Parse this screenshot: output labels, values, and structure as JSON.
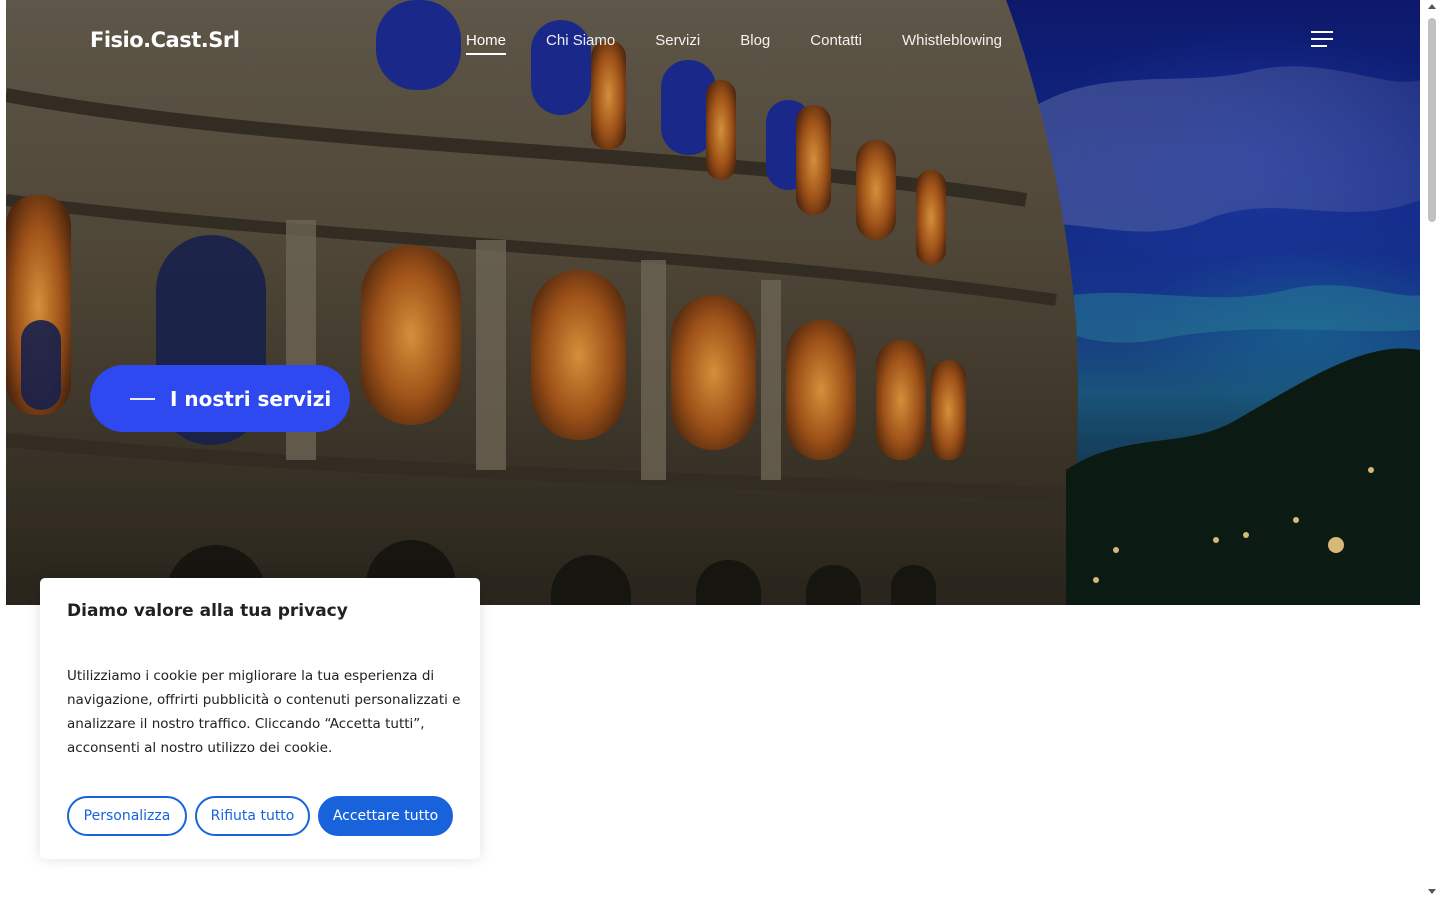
{
  "header": {
    "logo": "Fisio.Cast.Srl",
    "nav": [
      {
        "label": "Home",
        "active": true
      },
      {
        "label": "Chi Siamo",
        "active": false
      },
      {
        "label": "Servizi",
        "active": false
      },
      {
        "label": "Blog",
        "active": false
      },
      {
        "label": "Contatti",
        "active": false
      },
      {
        "label": "Whistleblowing",
        "active": false
      }
    ],
    "menu_icon": "hamburger-menu-icon"
  },
  "hero": {
    "cta_label": "I nostri servizi",
    "background": "colosseum-night-photo"
  },
  "cookie_banner": {
    "title": "Diamo valore alla tua privacy",
    "text": "Utilizziamo i cookie per migliorare la tua esperienza di navigazione, offrirti pubblicità o contenuti personalizzati e analizzare il nostro traffico. Cliccando “Accetta tutti”, acconsenti al nostro utilizzo dei cookie.",
    "buttons": {
      "customize": "Personalizza",
      "reject": "Rifiuta tutto",
      "accept": "Accettare tutto"
    }
  },
  "colors": {
    "cta": "#2f49f0",
    "cookie_accent": "#1863dc"
  }
}
